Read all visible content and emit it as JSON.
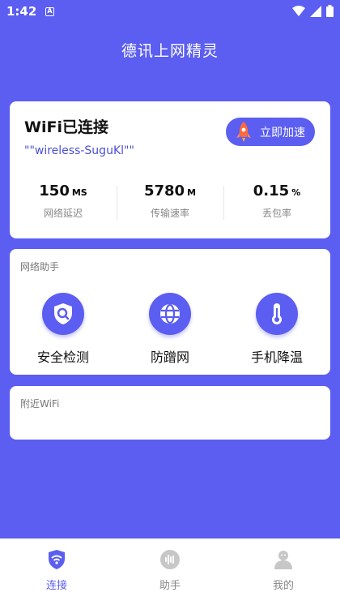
{
  "status_bar": {
    "time": "1:42",
    "notif_letter": "A"
  },
  "app": {
    "title": "德讯上网精灵"
  },
  "wifi_card": {
    "title": "WiFi已连接",
    "ssid": "\"\"wireless-SuguKl\"\"",
    "boost_label": "立即加速",
    "stats": [
      {
        "value": "150",
        "unit": "MS",
        "label": "网络延迟"
      },
      {
        "value": "5780",
        "unit": "M",
        "label": "传输速率"
      },
      {
        "value": "0.15",
        "unit": "%",
        "label": "丢包率"
      }
    ]
  },
  "tools_card": {
    "label": "网络助手",
    "items": [
      {
        "label": "安全检测",
        "icon": "shield-search-icon"
      },
      {
        "label": "防蹭网",
        "icon": "globe-icon"
      },
      {
        "label": "手机降温",
        "icon": "thermometer-icon"
      }
    ]
  },
  "nearby_card": {
    "label": "附近WiFi"
  },
  "bottom_nav": {
    "items": [
      {
        "label": "连接",
        "icon": "wifi-shield-icon",
        "active": true
      },
      {
        "label": "助手",
        "icon": "voice-icon",
        "active": false
      },
      {
        "label": "我的",
        "icon": "user-icon",
        "active": false
      }
    ]
  },
  "colors": {
    "primary": "#5b5ef0",
    "rocket": "#ff6a3d",
    "inactive_icon": "#bdbdbd"
  }
}
